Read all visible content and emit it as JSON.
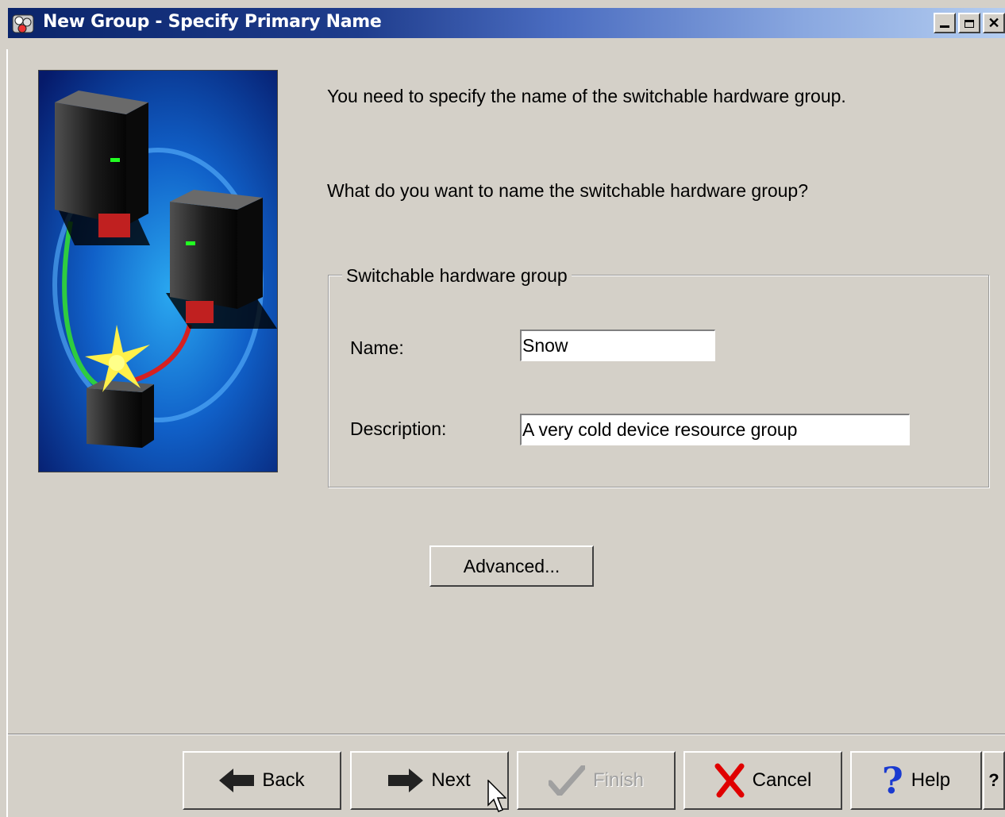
{
  "window": {
    "title": "New Group - Specify Primary Name",
    "controls": [
      "minimize",
      "maximize",
      "close"
    ]
  },
  "content": {
    "intro_text": "You need to specify the name of the switchable hardware group.",
    "question_text": "What do you want to name the switchable hardware group?",
    "group": {
      "legend": "Switchable hardware group",
      "name_label": "Name:",
      "name_value": "Snow",
      "description_label": "Description:",
      "description_value": "A very cold device resource group"
    },
    "advanced_label": "Advanced..."
  },
  "buttons": {
    "back": "Back",
    "next": "Next",
    "finish": "Finish",
    "cancel": "Cancel",
    "help": "Help",
    "extra": "?"
  }
}
